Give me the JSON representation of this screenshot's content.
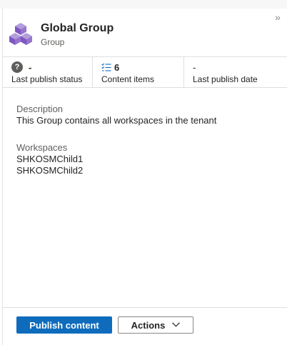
{
  "header": {
    "title": "Global Group",
    "subtitle": "Group",
    "icon": "group-cubes-icon",
    "accent": "#8661c5"
  },
  "stats": [
    {
      "icon": "question-circle-icon",
      "value": "-",
      "label": "Last publish status"
    },
    {
      "icon": "checklist-icon",
      "value": "6",
      "label": "Content items"
    },
    {
      "icon": "",
      "value": "-",
      "label": "Last publish date"
    }
  ],
  "description": {
    "label": "Description",
    "text": "This Group contains all workspaces in the tenant"
  },
  "workspaces": {
    "label": "Workspaces",
    "items": [
      "SHKOSMChild1",
      "SHKOSMChild2"
    ]
  },
  "footer": {
    "primary_label": "Publish content",
    "secondary_label": "Actions",
    "primary_color": "#0f6cbd"
  },
  "collapse_glyph": "»"
}
